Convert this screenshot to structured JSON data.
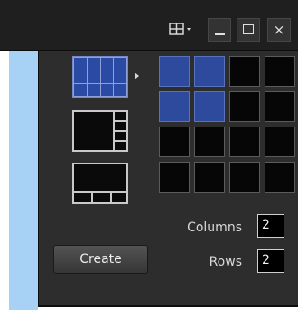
{
  "titlebar": {
    "layout_button_icon": "layout-grid-icon",
    "minimize_icon": "minimize-icon",
    "maximize_icon": "maximize-icon",
    "close_icon": "close-icon",
    "close_glyph": "×"
  },
  "presets": {
    "items": [
      "grid-4x3-preset",
      "main-plus-side-preset",
      "main-plus-bottom-preset"
    ],
    "selected": "grid-4x3-preset",
    "expand_icon": "caret-right-icon"
  },
  "cell_selector": {
    "total_columns": 4,
    "total_rows": 4,
    "selected_columns": 2,
    "selected_rows": 2
  },
  "fields": {
    "columns_label": "Columns",
    "columns_value": "2",
    "rows_label": "Rows",
    "rows_value": "2"
  },
  "create_label": "Create",
  "colors": {
    "panel_bg": "#2d2d2d",
    "titlebar_bg": "#1f1f1f",
    "selected_cell": "#2d4a9c",
    "left_accent": "#a8d2f5"
  }
}
